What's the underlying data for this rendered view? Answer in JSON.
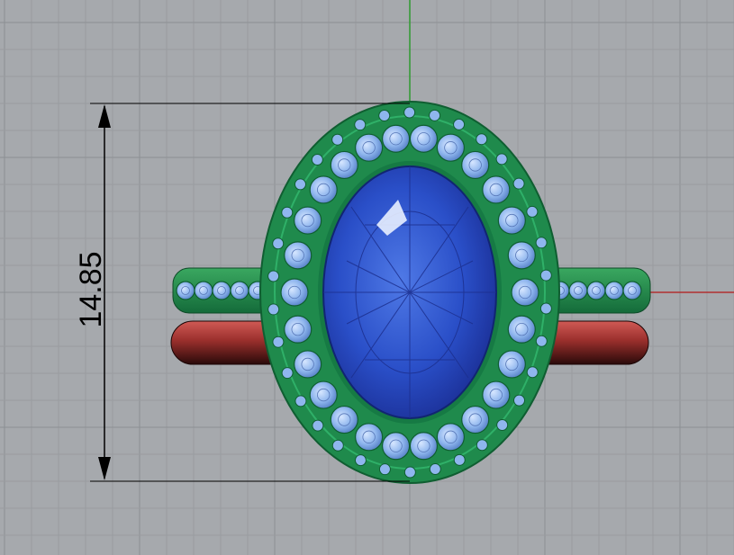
{
  "viewport": {
    "background_color": "#a6a9ad",
    "grid_minor_color": "#999ca0",
    "grid_major_color": "#8c8f93",
    "x_axis_color": "#b03030",
    "y_axis_color": "#2f9a2f"
  },
  "dimension": {
    "label": "14.85",
    "line_color": "#000000"
  },
  "model": {
    "center_stone_color": "#2a4fc8",
    "center_stone_dark_color": "#1b2f96",
    "halo_metal_color": "#1f8a4c",
    "accent_stone_color": "#8fb6ee",
    "shank_color": "#b5403e"
  }
}
